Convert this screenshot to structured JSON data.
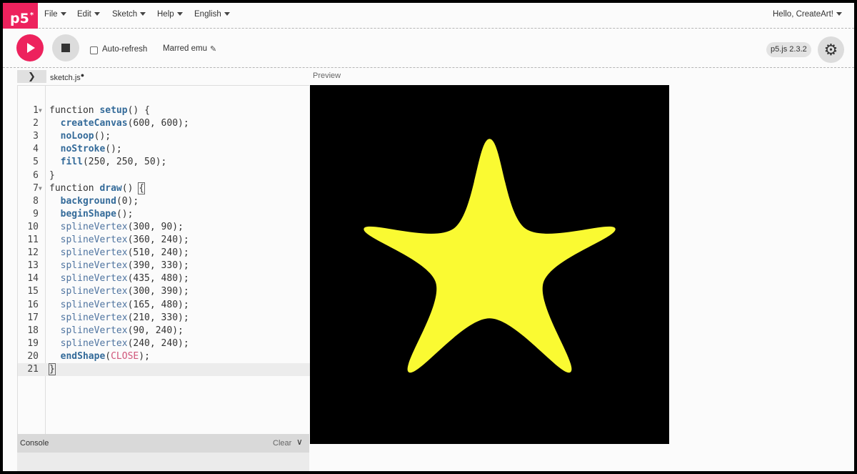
{
  "nav": {
    "logo": "p5",
    "logo_sup": "*",
    "menus": [
      "File",
      "Edit",
      "Sketch",
      "Help",
      "English"
    ],
    "greeting": "Hello, CreateArt!"
  },
  "toolbar": {
    "auto_refresh_label": "Auto-refresh",
    "auto_refresh_checked": false,
    "sketch_name": "Marred emu",
    "version": "p5.js 2.3.2"
  },
  "editor": {
    "file_name": "sketch.js",
    "unsaved_marker": "●",
    "preview_label": "Preview",
    "lines": [
      "function setup() {",
      "  createCanvas(600, 600);",
      "  noLoop();",
      "  noStroke();",
      "  fill(250, 250, 50);",
      "}",
      "function draw() {",
      "  background(0);",
      "  beginShape();",
      "  splineVertex(300, 90);",
      "  splineVertex(360, 240);",
      "  splineVertex(510, 240);",
      "  splineVertex(390, 330);",
      "  splineVertex(435, 480);",
      "  splineVertex(300, 390);",
      "  splineVertex(165, 480);",
      "  splineVertex(210, 330);",
      "  splineVertex(90, 240);",
      "  splineVertex(240, 240);",
      "  endShape(CLOSE);",
      "}"
    ]
  },
  "console": {
    "label": "Console",
    "clear_label": "Clear"
  },
  "preview": {
    "background": "#000000",
    "fill": "#fafa32"
  },
  "colors": {
    "accent": "#ed225d"
  }
}
